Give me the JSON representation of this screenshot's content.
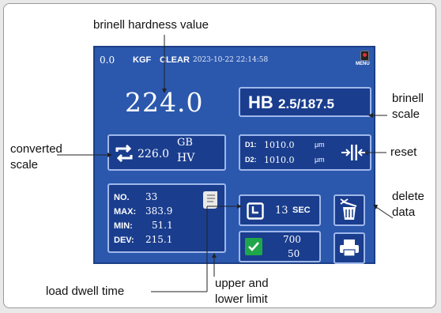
{
  "screen": {
    "status": {
      "load_value": "0.0",
      "unit": "KGF",
      "clear_label": "CLEAR",
      "datetime": "2023-10-22 22:14:58",
      "menu_label": "MENU"
    },
    "hardness_value": "224.0",
    "scale": {
      "prefix": "HB",
      "value": "2.5/187.5"
    },
    "converted": {
      "value": "226.0",
      "scale_top": "GB",
      "scale_bottom": "HV"
    },
    "diameters": {
      "d1_label": "D1:",
      "d1_value": "1010.0",
      "d1_unit": "μm",
      "d2_label": "D2:",
      "d2_value": "1010.0",
      "d2_unit": "μm"
    },
    "stats": {
      "no_label": "NO.",
      "no_value": "33",
      "max_label": "MAX:",
      "max_value": "383.9",
      "min_label": "MIN:",
      "min_value": "51.1",
      "dev_label": "DEV:",
      "dev_value": "215.1"
    },
    "dwell": {
      "value": "13",
      "unit": "SEC"
    },
    "limits": {
      "upper": "700",
      "lower": "50"
    }
  },
  "annotations": {
    "hardness_value": "brinell hardness value",
    "brinell_scale_1": "brinell",
    "brinell_scale_2": "scale",
    "converted_scale_1": "converted",
    "converted_scale_2": "scale",
    "reset": "reset",
    "delete_data_1": "delete",
    "delete_data_2": "data",
    "load_dwell_time": "load dwell time",
    "limits_1": "upper and",
    "limits_2": "lower limit"
  },
  "colors": {
    "screen_bg": "#2b58ad",
    "panel_bg": "#1a3d8e",
    "panel_border": "#9fb8ea",
    "clear_text": "#ffffff",
    "check_green": "#1fa64a"
  }
}
